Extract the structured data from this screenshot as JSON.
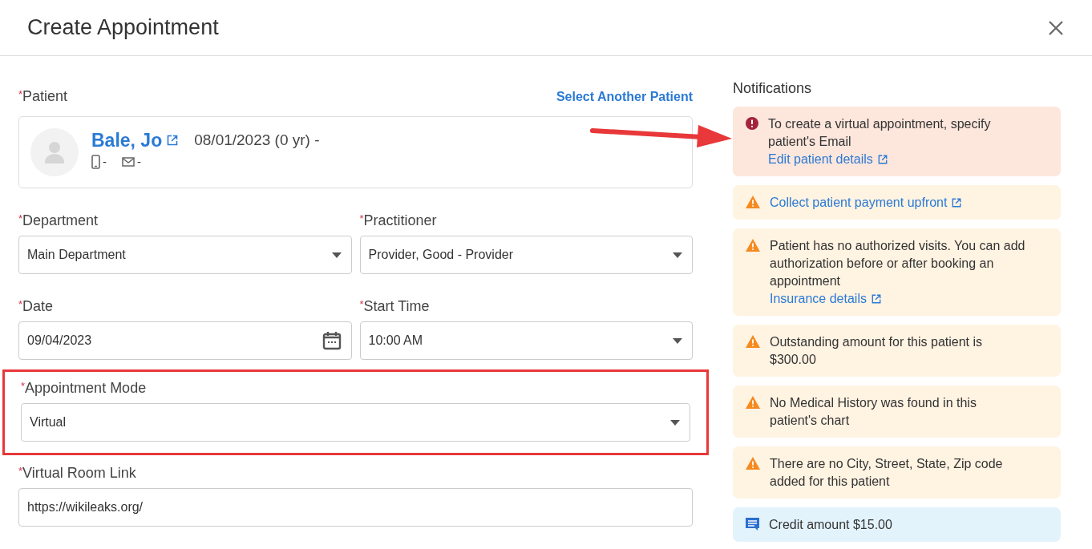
{
  "window": {
    "title": "Create Appointment"
  },
  "patient": {
    "mark": "*",
    "label": "Patient",
    "action": "Select Another Patient",
    "name": "Bale, Jo",
    "dob": "08/01/2023 (0 yr) -",
    "phone": "-",
    "email": "-"
  },
  "fields": [
    {
      "kind": "select",
      "mark": "*",
      "label": "Department",
      "value": "Main Department"
    },
    {
      "kind": "select",
      "mark": "*",
      "label": "Practitioner",
      "value": "Provider, Good - Provider"
    },
    {
      "kind": "date",
      "mark": "*",
      "label": "Date",
      "value": "09/04/2023"
    },
    {
      "kind": "select",
      "mark": "*",
      "label": "Start Time",
      "value": "10:00 AM"
    },
    {
      "kind": "select",
      "mark": "*",
      "label": "Appointment Mode",
      "value": "Virtual",
      "highlighted": true
    },
    {
      "kind": "text",
      "mark": "*",
      "label": "Virtual Room Link",
      "value": "https://wikileaks.org/"
    }
  ],
  "notifications": {
    "title": "Notifications",
    "items": [
      {
        "kind": "error",
        "text": "To create a virtual appointment, specify patient's Email",
        "link": "Edit patient details"
      },
      {
        "kind": "warning",
        "link": "Collect patient payment upfront"
      },
      {
        "kind": "warning",
        "text": "Patient has no authorized visits. You can add authorization before or after booking an appointment",
        "link": "Insurance details"
      },
      {
        "kind": "warning",
        "text": "Outstanding amount for this patient is $300.00"
      },
      {
        "kind": "warning",
        "text": "No Medical History was found in this patient's chart"
      },
      {
        "kind": "warning",
        "text": "There are no City, Street, State, Zip code added for this patient"
      },
      {
        "kind": "info",
        "text": "Credit amount $15.00"
      }
    ]
  }
}
